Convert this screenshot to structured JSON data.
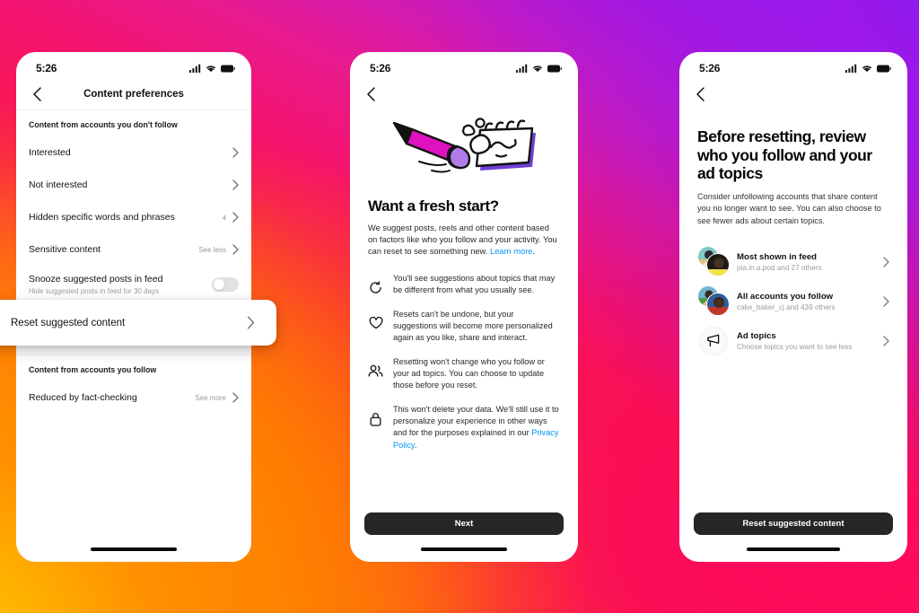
{
  "background": {
    "gradient_colors": [
      "#ffc500",
      "#ff9000",
      "#ff5a1e",
      "#f91c4a",
      "#f5136b",
      "#e81a8e",
      "#c71bc0",
      "#9a18e4",
      "#8a10f0"
    ],
    "description": "instagram-brand-gradient"
  },
  "status_bar": {
    "time": "5:26"
  },
  "phone1": {
    "nav": {
      "back_icon": "chevron-left-icon",
      "title": "Content preferences"
    },
    "section1_header": "Content from accounts you don't follow",
    "rows": [
      {
        "title": "Interested",
        "value": "",
        "count": "",
        "chevron": true
      },
      {
        "title": "Not interested",
        "value": "",
        "count": "",
        "chevron": true
      },
      {
        "title": "Hidden specific words and phrases",
        "value": "",
        "count": "4",
        "chevron": true
      },
      {
        "title": "Sensitive content",
        "value": "See less",
        "count": "",
        "chevron": true
      }
    ],
    "snooze": {
      "title": "Snooze suggested posts in feed",
      "subtitle": "Hide suggested posts in feed for 30 days",
      "toggle_state": "off"
    },
    "highlight_card": {
      "title": "Reset suggested content",
      "chevron": true
    },
    "section2_header": "Content from accounts you follow",
    "rows2": [
      {
        "title": "Reduced by fact-checking",
        "value": "See more",
        "chevron": true
      }
    ]
  },
  "phone2": {
    "nav": {
      "back_icon": "chevron-left-icon"
    },
    "illustration": "pencil-erasing-notepad-illustration",
    "heading": "Want a fresh start?",
    "paragraph": "We suggest posts, reels and other content based on factors like who you follow and your activity. You can reset to see something new.",
    "paragraph_link": "Learn more",
    "paragraph_link_tail": ".",
    "bullets": [
      {
        "icon": "refresh-arrow-icon",
        "text": "You'll see suggestions about topics that may be different from what you usually see."
      },
      {
        "icon": "heart-icon",
        "text": "Resets can't be undone, but your suggestions will become more personalized again as you like, share and interact."
      },
      {
        "icon": "people-icon",
        "text": "Resetting won't change who you follow or your ad topics. You can choose to update those before you reset."
      },
      {
        "icon": "lock-icon",
        "text": "This won't delete your data. We'll still use it to personalize your experience in other ways and for the purposes explained in our ",
        "link": "Privacy Policy",
        "tail": "."
      }
    ],
    "cta_label": "Next"
  },
  "phone3": {
    "nav": {
      "back_icon": "chevron-left-icon"
    },
    "title": "Before resetting, review who you follow and your ad topics",
    "subtitle": "Consider unfollowing accounts that share content you no longer want to see. You can also choose to see fewer ads about certain topics.",
    "items": [
      {
        "icon": "avatar-stack",
        "title": "Most shown in feed",
        "subtitle": "pia.in.a.pod and 27 others",
        "avatar_back_color": "#7fc9c6",
        "avatar_front_color": "#2f2a23",
        "chevron": true
      },
      {
        "icon": "avatar-stack",
        "title": "All accounts you follow",
        "subtitle": "cake_baker_cj and 439 others",
        "avatar_back_color": "#5f9f58",
        "avatar_front_color": "#c0392b",
        "chevron": true
      },
      {
        "icon": "megaphone-icon",
        "title": "Ad topics",
        "subtitle": "Choose topics you want to see less",
        "chevron": true
      }
    ],
    "cta_label": "Reset suggested content"
  },
  "colors": {
    "cta_background": "#262626",
    "link": "#0095f6",
    "muted_text": "#9a9a9a",
    "primary_text": "#111111"
  }
}
